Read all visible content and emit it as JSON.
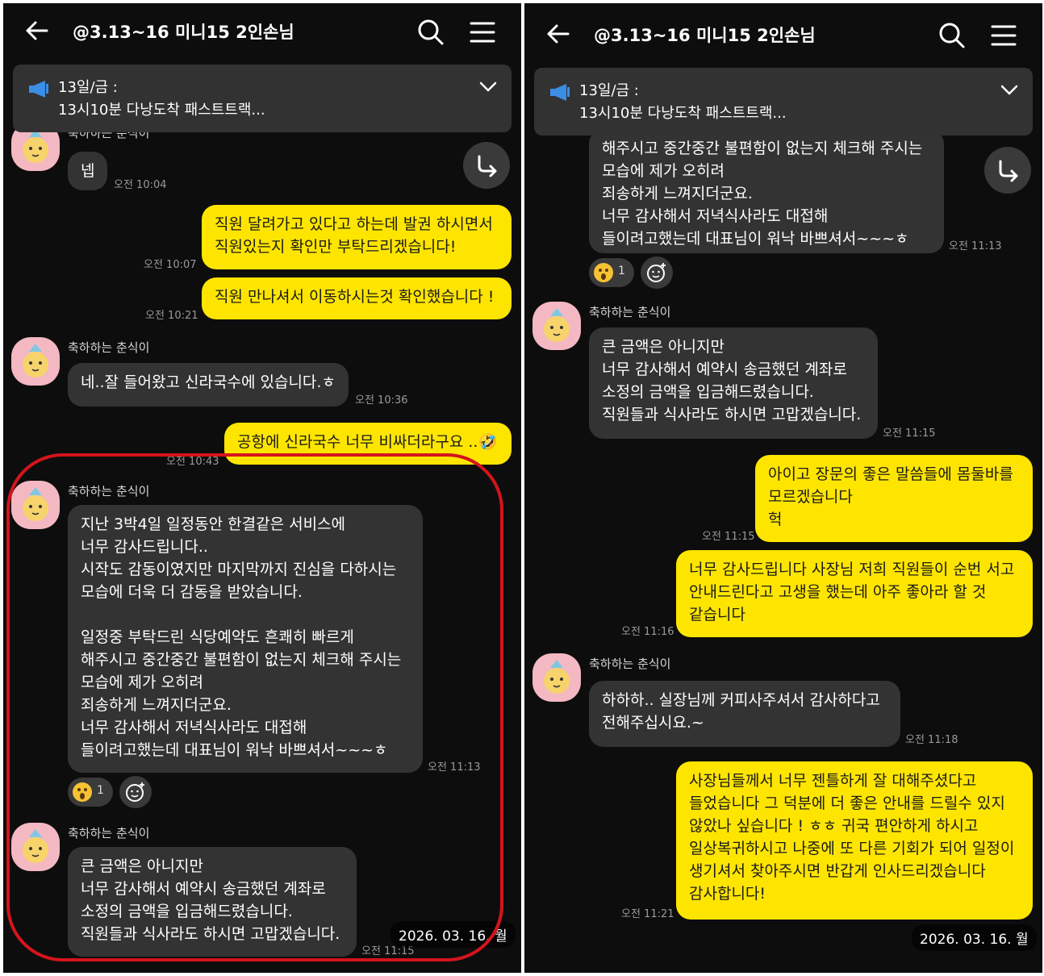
{
  "chat_title": "@3.13~16 미니15 2인손님",
  "notice": {
    "line1": "13일/금 :",
    "line2": "13시10분 다낭도착 패스트트랙..."
  },
  "left": {
    "m_partial_sender": "축하하는 춘식이",
    "m1": {
      "text": "넵",
      "time": "오전 10:04"
    },
    "m2": {
      "text": "직원 달려가고 있다고 하는데 발권 하시면서\n직원있는지  확인만 부탁드리겠습니다!",
      "time": "오전 10:07"
    },
    "m3": {
      "text": "직원 만나셔서 이동하시는것 확인했습니다 !",
      "time": "오전 10:21"
    },
    "m4": {
      "sender": "축하하는 춘식이",
      "text": "네..잘 들어왔고 신라국수에 있습니다.ㅎ",
      "time": "오전 10:36"
    },
    "m5": {
      "text": "공항에 신라국수 너무 비싸더라구요 ..🤣",
      "time": "오전 10:43"
    },
    "m6": {
      "sender": "축하하는 춘식이",
      "text": "지난 3박4일 일정동안 한결같은 서비스에\n너무 감사드립니다..\n시작도 감동이였지만 마지막까지 진심을 다하시는\n모습에 더욱 더 감동을 받았습니다.\n\n일정중 부탁드린 식당예약도 흔쾌히 빠르게\n해주시고 중간중간 불편함이 없는지 체크해 주시는\n모습에 제가 오히려\n죄송하게 느껴지더군요.\n너무 감사해서 저녁식사라도 대접해\n들이려고했는데 대표님이 워낙 바쁘셔서~~~ㅎ",
      "time": "오전 11:13",
      "reaction_count": "1"
    },
    "m7": {
      "sender": "축하하는 춘식이",
      "text": "큰 금액은 아니지만\n너무 감사해서 예약시 송금했던 계좌로\n 소정의 금액을 입금해드렸습니다.\n직원들과 식사라도 하시면 고맙겠습니다.",
      "time": "오전 11:15"
    },
    "date": "2026. 03. 16. 월"
  },
  "right": {
    "m6_tail": {
      "text": "해주시고 중간중간 불편함이 없는지 체크해 주시는\n모습에 제가 오히려\n죄송하게 느껴지더군요.\n너무 감사해서 저녁식사라도 대접해\n들이려고했는데 대표님이 워낙 바쁘셔서~~~ㅎ",
      "time": "오전 11:13",
      "reaction_count": "1"
    },
    "m7": {
      "sender": "축하하는 춘식이",
      "text": "큰 금액은 아니지만\n너무 감사해서 예약시 송금했던 계좌로\n 소정의 금액을 입금해드렸습니다.\n직원들과 식사라도 하시면 고맙겠습니다.",
      "time": "오전 11:15"
    },
    "m8": {
      "text": "아이고 장문의 좋은 말씀들에 몸둘바를\n모르겠습니다\n헉",
      "time": "오전 11:15"
    },
    "m9": {
      "text": "너무 감사드립니다 사장님 저희 직원들이 순번 서고\n안내드린다고 고생을 했는데 아주 좋아라 할 것\n같습니다",
      "time": "오전 11:16"
    },
    "m10": {
      "sender": "축하하는 춘식이",
      "text": "하하하.. 실장님께 커피사주셔서 감사하다고\n전해주십시요.~",
      "time": "오전 11:18"
    },
    "m11": {
      "text": "사장님들께서 너무 젠틀하게 잘 대해주셨다고\n들었습니다 그 덕분에 더 좋은 안내를 드릴수 있지\n않았나 싶습니다 ! ㅎㅎ 귀국 편안하게 하시고\n일상복귀하시고 나중에 또 다른 기회가 되어 일정이\n생기셔서 찾아주시면 반갑게 인사드리겠습니다\n감사합니다!",
      "time": "오전 11:21"
    },
    "date": "2026. 03. 16. 월"
  },
  "colors": {
    "bubble_out": "#fee500",
    "bubble_in": "#333333",
    "background": "#0d0d0d",
    "highlight": "#d4141c"
  },
  "icons": [
    "back-arrow-icon",
    "search-icon",
    "menu-icon",
    "megaphone-icon",
    "chevron-down-icon",
    "forward-share-icon",
    "add-reaction-icon",
    "surprised-emoji-icon",
    "avatar-chunsik"
  ]
}
